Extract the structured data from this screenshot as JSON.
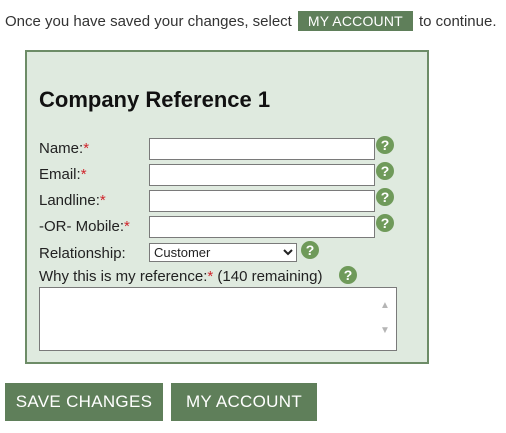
{
  "intro": {
    "before": "Once you have saved your changes, select",
    "button": "MY ACCOUNT",
    "after": "to continue."
  },
  "form": {
    "title": "Company Reference 1",
    "required_mark": "*",
    "help_glyph": "?",
    "fields": {
      "name": {
        "label": "Name:",
        "value": ""
      },
      "email": {
        "label": "Email:",
        "value": ""
      },
      "landline": {
        "label": "Landline:",
        "value": ""
      },
      "mobile": {
        "label": "-OR- Mobile:",
        "value": ""
      }
    },
    "relationship": {
      "label": "Relationship:",
      "selected": "Customer"
    },
    "why": {
      "label": "Why this is my reference:",
      "remaining": "(140 remaining)",
      "value": ""
    }
  },
  "actions": {
    "save": "SAVE CHANGES",
    "account": "MY ACCOUNT"
  },
  "colors": {
    "accent": "#5f7f5a",
    "panel_bg": "#dfeadf",
    "required": "#d0242b",
    "help_icon": "#6f9a5a"
  },
  "icons": {
    "help": "help-icon",
    "dropdown": "chevron-down-icon"
  }
}
